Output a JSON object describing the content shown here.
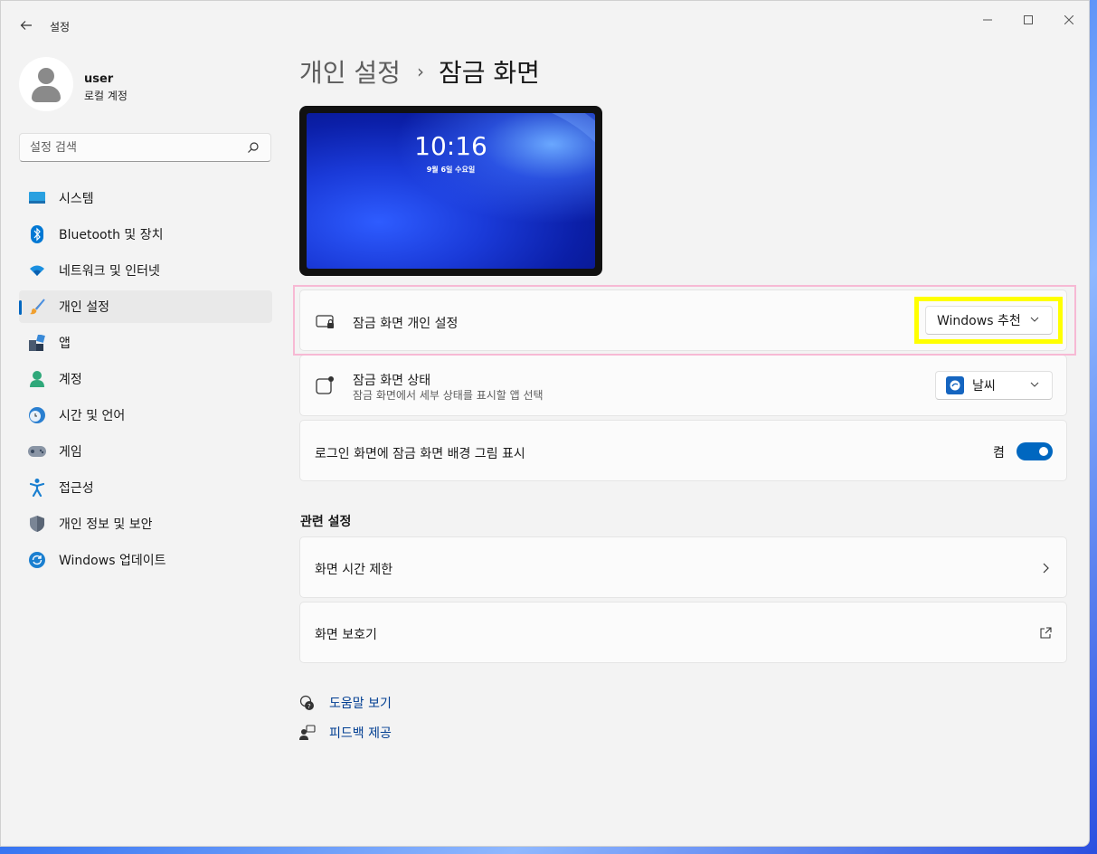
{
  "window": {
    "app_title": "설정",
    "controls": {
      "minimize": "—",
      "maximize": "",
      "close": "✕"
    }
  },
  "profile": {
    "name": "user",
    "account_type": "로컬 계정"
  },
  "search": {
    "placeholder": "설정 검색"
  },
  "sidebar": {
    "items": [
      {
        "label": "시스템",
        "icon": "system-icon"
      },
      {
        "label": "Bluetooth 및 장치",
        "icon": "bluetooth-icon"
      },
      {
        "label": "네트워크 및 인터넷",
        "icon": "wifi-icon"
      },
      {
        "label": "개인 설정",
        "icon": "brush-icon",
        "active": true
      },
      {
        "label": "앱",
        "icon": "apps-icon"
      },
      {
        "label": "계정",
        "icon": "account-icon"
      },
      {
        "label": "시간 및 언어",
        "icon": "time-language-icon"
      },
      {
        "label": "게임",
        "icon": "gamepad-icon"
      },
      {
        "label": "접근성",
        "icon": "accessibility-icon"
      },
      {
        "label": "개인 정보 및 보안",
        "icon": "shield-icon"
      },
      {
        "label": "Windows 업데이트",
        "icon": "update-icon"
      }
    ]
  },
  "header": {
    "parent": "개인 설정",
    "separator": "›",
    "current": "잠금 화면"
  },
  "preview": {
    "time": "10:16",
    "date": "9월 6일 수요일"
  },
  "settings": {
    "personalize": {
      "title": "잠금 화면 개인 설정",
      "value": "Windows 추천"
    },
    "status": {
      "title": "잠금 화면 상태",
      "subtitle": "잠금 화면에서 세부 상태를 표시할 앱 선택",
      "value": "날씨"
    },
    "signin_background": {
      "title": "로그인 화면에 잠금 화면 배경 그림 표시",
      "state_label": "켬",
      "on": true
    }
  },
  "related": {
    "title": "관련 설정",
    "items": [
      {
        "label": "화면 시간 제한",
        "icon": "chevron-right-icon"
      },
      {
        "label": "화면 보호기",
        "icon": "external-link-icon"
      }
    ]
  },
  "links": {
    "help": "도움말 보기",
    "feedback": "피드백 제공"
  },
  "colors": {
    "accent": "#0067c0",
    "highlight_pink": "#f7b9d4",
    "highlight_yellow": "#ffff00"
  }
}
